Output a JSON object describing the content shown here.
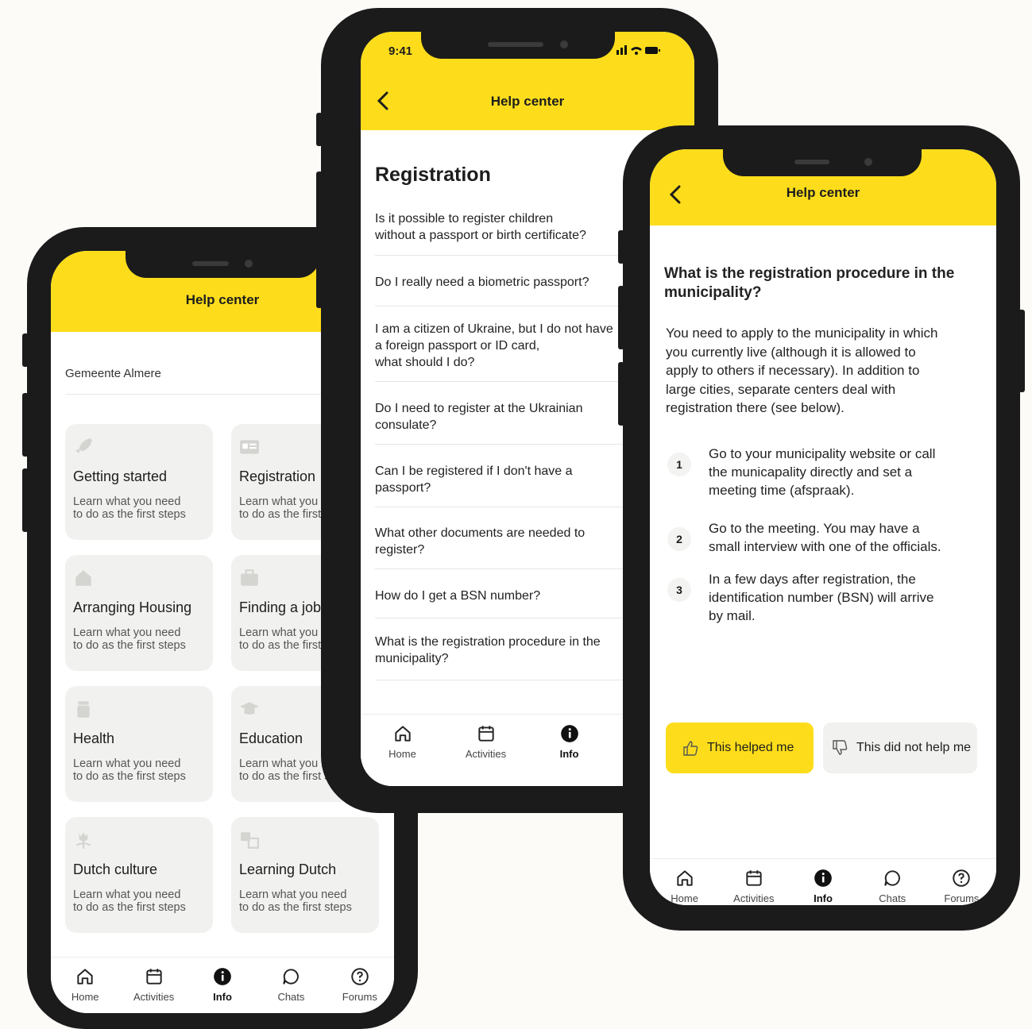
{
  "phone1": {
    "title": "Help center",
    "municipality": "Gemeente Almere",
    "cards": [
      {
        "title": "Getting started",
        "subtitle": "Learn what you need\nto do as the first steps",
        "icon": "rocket-icon"
      },
      {
        "title": "Registration",
        "subtitle": "Learn what you need\nto do as the first steps",
        "icon": "id-card-icon"
      },
      {
        "title": "Arranging Housing",
        "subtitle": "Learn what you need\nto do as the first steps",
        "icon": "house-icon"
      },
      {
        "title": "Finding a job",
        "subtitle": "Learn what you need\nto do as the first steps",
        "icon": "briefcase-icon"
      },
      {
        "title": "Health",
        "subtitle": "Learn what you need\nto do as the first steps",
        "icon": "medicine-icon"
      },
      {
        "title": "Education",
        "subtitle": "Learn what you need\nto do as the first steps",
        "icon": "graduation-cap-icon"
      },
      {
        "title": "Dutch culture",
        "subtitle": "Learn what you need\nto do as the first steps",
        "icon": "tulip-icon"
      },
      {
        "title": "Learning Dutch",
        "subtitle": "Learn what you need\nto do as the first steps",
        "icon": "translate-icon"
      }
    ],
    "nav": [
      "Home",
      "Activities",
      "Info",
      "Chats",
      "Forums"
    ]
  },
  "phone2": {
    "time": "9:41",
    "title": "Help center",
    "heading": "Registration",
    "questions": [
      "Is it possible to register children\nwithout a passport or birth certificate?",
      "Do I really need a biometric passport?",
      "I am a citizen of Ukraine, but I do not have\na foreign passport or ID card,\nwhat should I do?",
      "Do I need to register at the Ukrainian\nconsulate?",
      "Can I be registered if I don't have a\npassport?",
      "What other documents are needed to\nregister?",
      "How do I get a BSN number?",
      "What is the registration procedure in the\nmunicipality?"
    ],
    "nav": [
      "Home",
      "Activities",
      "Info",
      "Chats"
    ]
  },
  "phone3": {
    "title": "Help center",
    "question": "What is the registration procedure in the\nmunicipality?",
    "body": "You need to apply to the municipality in which\nyou currently live (although it is allowed to\napply to others if necessary). In addition to\nlarge cities, separate centers deal with\nregistration there (see below).",
    "steps": [
      {
        "num": "1",
        "text": "Go to your municipality website or call\nthe municapality directly and set a\nmeeting time (afspraak)."
      },
      {
        "num": "2",
        "text": "Go to the meeting. You may have a\nsmall interview with one of the officials."
      },
      {
        "num": "3",
        "text": "In a few days after registration, the\nidentification number (BSN) will arrive\nby mail."
      }
    ],
    "helped": "This helped me",
    "not_helped": "This did not help me",
    "nav": [
      "Home",
      "Activities",
      "Info",
      "Chats",
      "Forums"
    ]
  },
  "colors": {
    "accent": "#fddd1b",
    "frame": "#1b1b1b",
    "card": "#f1f1ef",
    "background": "#fcfbf8"
  }
}
